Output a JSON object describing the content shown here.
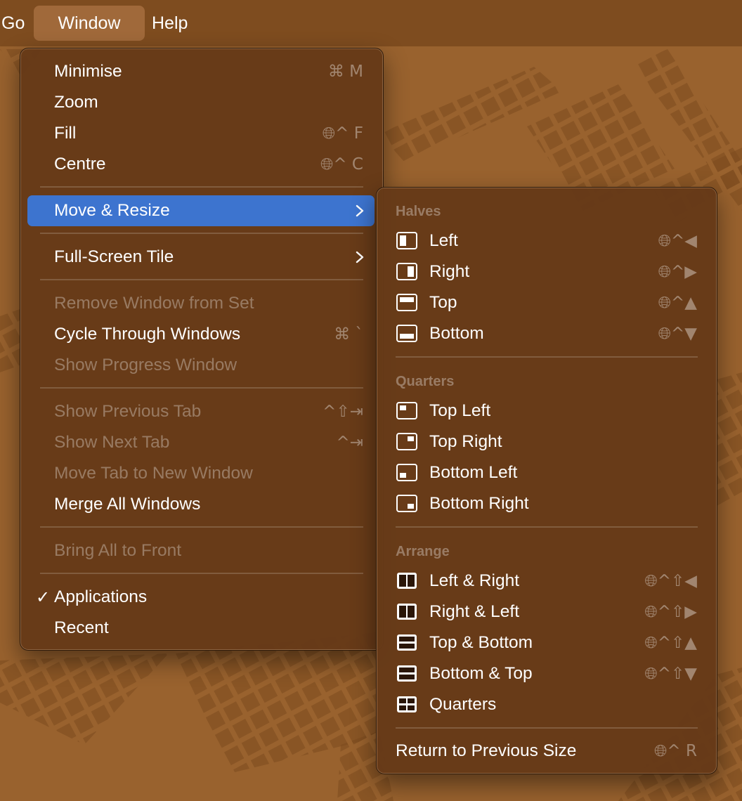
{
  "menubar": {
    "items": [
      "Go",
      "Window",
      "Help"
    ]
  },
  "window_menu": {
    "items": {
      "minimise": {
        "label": "Minimise",
        "shortcut": "⌘ M",
        "enabled": true
      },
      "zoom": {
        "label": "Zoom",
        "shortcut": "",
        "enabled": true
      },
      "fill": {
        "label": "Fill",
        "shortcut": "🌐︎^ F",
        "enabled": true
      },
      "centre": {
        "label": "Centre",
        "shortcut": "🌐︎^ C",
        "enabled": true
      },
      "move_resize": {
        "label": "Move & Resize",
        "submenu": true,
        "highlighted": true
      },
      "full_screen_tile": {
        "label": "Full-Screen Tile",
        "submenu": true
      },
      "remove_window": {
        "label": "Remove Window from Set",
        "enabled": false
      },
      "cycle_windows": {
        "label": "Cycle Through Windows",
        "shortcut": "⌘ `",
        "enabled": true
      },
      "show_progress": {
        "label": "Show Progress Window",
        "enabled": false
      },
      "prev_tab": {
        "label": "Show Previous Tab",
        "shortcut": "^⇧⇥",
        "enabled": false
      },
      "next_tab": {
        "label": "Show Next Tab",
        "shortcut": "^⇥",
        "enabled": false
      },
      "move_tab": {
        "label": "Move Tab to New Window",
        "enabled": false
      },
      "merge_windows": {
        "label": "Merge All Windows",
        "enabled": true
      },
      "bring_front": {
        "label": "Bring All to Front",
        "enabled": false
      },
      "applications": {
        "label": "Applications",
        "checked": true,
        "check": "✓"
      },
      "recent": {
        "label": "Recent"
      }
    }
  },
  "move_resize_submenu": {
    "halves": {
      "header": "Halves",
      "left": {
        "label": "Left",
        "shortcut": "🌐︎^◀",
        "icon": "tile-left-half-icon"
      },
      "right": {
        "label": "Right",
        "shortcut": "🌐︎^▶",
        "icon": "tile-right-half-icon"
      },
      "top": {
        "label": "Top",
        "shortcut": "🌐︎^▲",
        "icon": "tile-top-half-icon"
      },
      "bottom": {
        "label": "Bottom",
        "shortcut": "🌐︎^▼",
        "icon": "tile-bottom-half-icon"
      }
    },
    "quarters": {
      "header": "Quarters",
      "top_left": {
        "label": "Top Left",
        "icon": "tile-top-left-icon"
      },
      "top_right": {
        "label": "Top Right",
        "icon": "tile-top-right-icon"
      },
      "bottom_left": {
        "label": "Bottom Left",
        "icon": "tile-bottom-left-icon"
      },
      "bottom_right": {
        "label": "Bottom Right",
        "icon": "tile-bottom-right-icon"
      }
    },
    "arrange": {
      "header": "Arrange",
      "left_right": {
        "label": "Left & Right",
        "shortcut": "🌐︎^⇧◀",
        "icon": "arrange-left-right-icon"
      },
      "right_left": {
        "label": "Right & Left",
        "shortcut": "🌐︎^⇧▶",
        "icon": "arrange-right-left-icon"
      },
      "top_bottom": {
        "label": "Top & Bottom",
        "shortcut": "🌐︎^⇧▲",
        "icon": "arrange-top-bottom-icon"
      },
      "bottom_top": {
        "label": "Bottom & Top",
        "shortcut": "🌐︎^⇧▼",
        "icon": "arrange-bottom-top-icon"
      },
      "quarters": {
        "label": "Quarters",
        "icon": "arrange-quarters-icon"
      }
    },
    "return_previous": {
      "label": "Return to Previous Size",
      "shortcut": "🌐︎^ R"
    }
  },
  "colors": {
    "wallpaper": "#99622e",
    "menubar": "#7e4c1f",
    "menu_bg": "#663a18",
    "highlight": "#3d74cf"
  }
}
